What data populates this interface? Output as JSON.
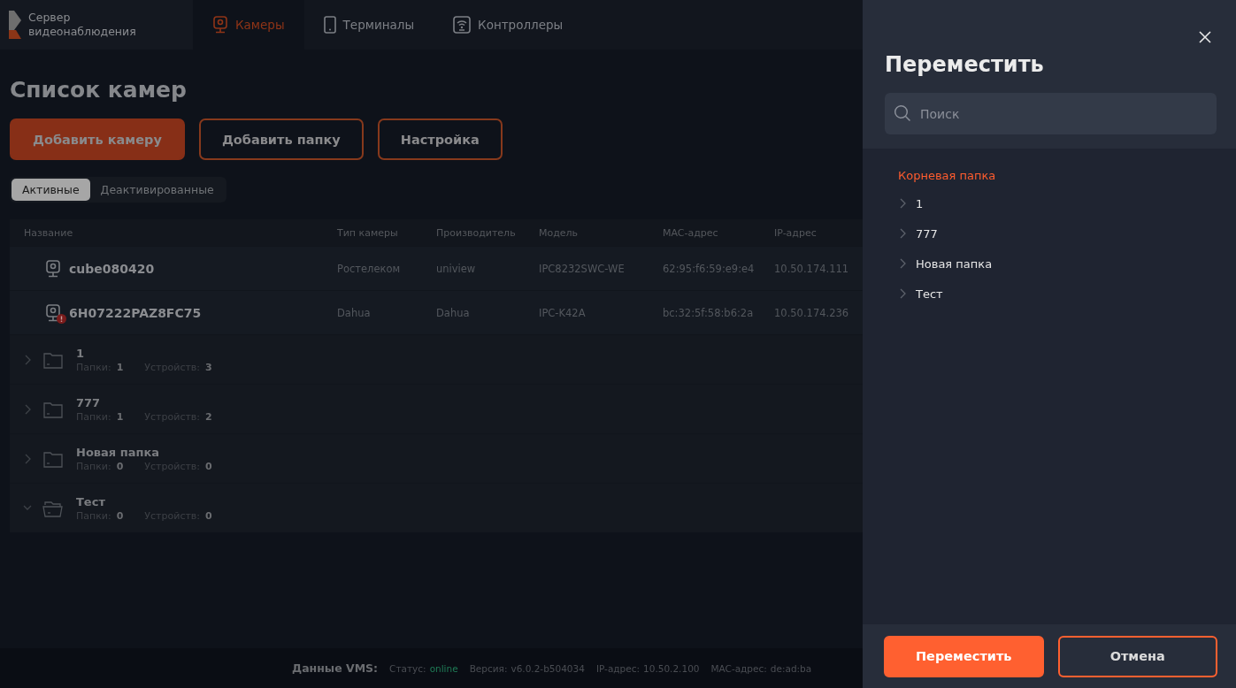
{
  "logo": {
    "text": "Сервер видеонаблюдения"
  },
  "nav_tabs": [
    {
      "label": "Камеры",
      "kind": "camera",
      "selected": true
    },
    {
      "label": "Терминалы",
      "kind": "tablet",
      "selected": false
    },
    {
      "label": "Контроллеры",
      "kind": "controller",
      "selected": false
    }
  ],
  "page_title": "Список камер",
  "actions": [
    {
      "label": "Добавить камеру",
      "kind": "primary"
    },
    {
      "label": "Добавить папку",
      "kind": "outline"
    },
    {
      "label": "Настройка",
      "kind": "outline"
    }
  ],
  "filter_tabs": [
    {
      "label": "Активные",
      "selected": true
    },
    {
      "label": "Деактивированные",
      "selected": false
    }
  ],
  "table": {
    "columns": [
      "Название",
      "Тип камеры",
      "Производитель",
      "Модель",
      "MAC-адрес",
      "IP-адрес"
    ],
    "rows": [
      {
        "cells": [
          "cube080420",
          "Ростелеком",
          "uniview",
          "IPC8232SWC-WE",
          "62:95:f6:59:e9:e4",
          "10.50.174.111"
        ],
        "alert": false
      },
      {
        "cells": [
          "6H07222PAZ8FC75",
          "Dahua",
          "Dahua",
          "IPC-K42A",
          "bc:32:5f:58:b6:2a",
          "10.50.174.236"
        ],
        "alert": true
      }
    ],
    "folders": [
      {
        "name": "1",
        "folders_label": "Папки:",
        "folders": "1",
        "devices_label": "Устройств:",
        "devices": "3",
        "expanded": false
      },
      {
        "name": "777",
        "folders_label": "Папки:",
        "folders": "1",
        "devices_label": "Устройств:",
        "devices": "2",
        "expanded": false
      },
      {
        "name": "Новая папка",
        "folders_label": "Папки:",
        "folders": "0",
        "devices_label": "Устройств:",
        "devices": "0",
        "expanded": false
      },
      {
        "name": "Тест",
        "folders_label": "Папки:",
        "folders": "0",
        "devices_label": "Устройств:",
        "devices": "0",
        "expanded": true
      }
    ]
  },
  "status_bar": {
    "label": "Данные VMS:",
    "items": [
      {
        "label": "Статус:",
        "value": "online",
        "kind": "status"
      },
      {
        "label": "Версия:",
        "value": "v6.0.2-b504034",
        "kind": "plain"
      },
      {
        "label": "IP-адрес:",
        "value": "10.50.2.100",
        "kind": "plain"
      },
      {
        "label": "MAC-адрес:",
        "value": "de:ad:ba",
        "kind": "plain"
      }
    ]
  },
  "drawer": {
    "title": "Переместить",
    "search": {
      "placeholder": "Поиск"
    },
    "tree": {
      "label": "Корневая папка",
      "selected": true,
      "children": [
        {
          "label": "1",
          "selected": false,
          "expanded": false
        },
        {
          "label": "777",
          "selected": false,
          "expanded": false
        },
        {
          "label": "Новая папка",
          "selected": false,
          "expanded": false
        },
        {
          "label": "Тест",
          "selected": false,
          "expanded": false
        }
      ]
    },
    "buttons": [
      {
        "label": "Переместить",
        "kind": "primary"
      },
      {
        "label": "Отмена",
        "kind": "outline"
      }
    ]
  }
}
